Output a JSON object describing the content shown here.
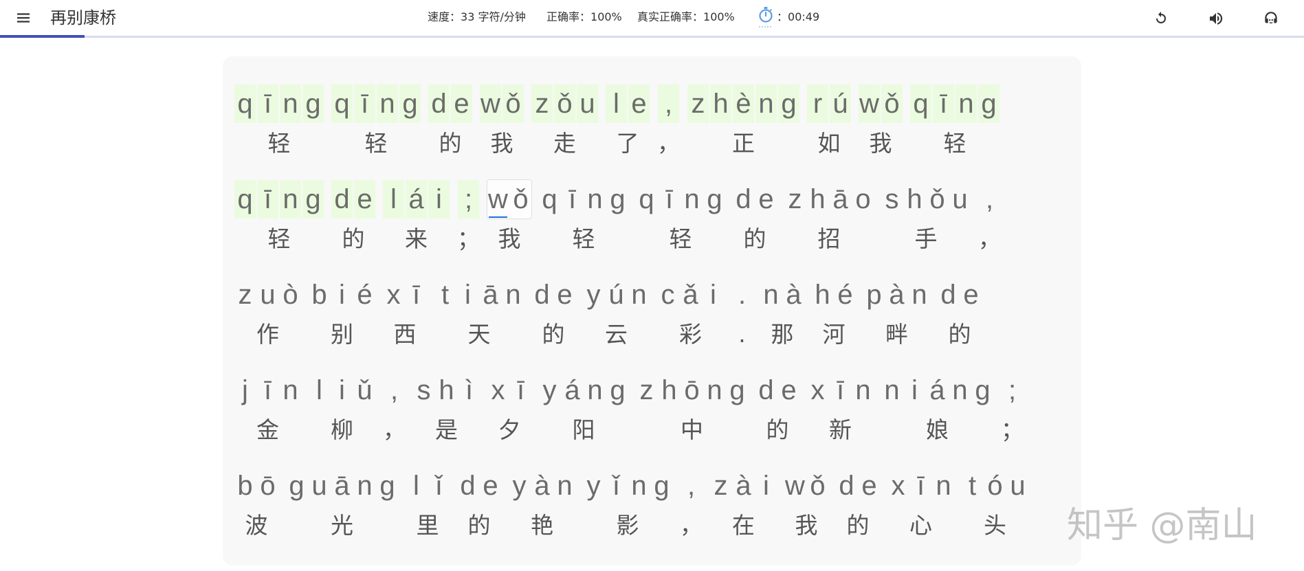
{
  "header": {
    "title": "再别康桥",
    "progress": 0.065,
    "stats": {
      "speed_label": "速度：",
      "speed_value": "33 字符/分钟",
      "accuracy_label": "正确率：",
      "accuracy_value": "100%",
      "real_accuracy_label": "真实正确率：",
      "real_accuracy_value": "100%",
      "timer_sep": "：",
      "timer_value": "00:49"
    }
  },
  "icons": {
    "menu": "menu-icon",
    "stopwatch": "stopwatch-icon",
    "restart": "refresh-icon",
    "sound": "volume-icon",
    "support": "headset-icon"
  },
  "colors": {
    "accent": "#3f51b5",
    "typed_bg": "#ebfbdf",
    "cursor": "#1e6fd9",
    "stopwatch": "#5c9ce6"
  },
  "cursor": {
    "line": 1,
    "word": 4,
    "letter": 0
  },
  "lines": [
    [
      {
        "py": "qīng",
        "hz": "轻"
      },
      {
        "py": "qīng",
        "hz": "轻"
      },
      {
        "py": "de",
        "hz": "的"
      },
      {
        "py": "wǒ",
        "hz": "我"
      },
      {
        "py": "zǒu",
        "hz": "走"
      },
      {
        "py": "le",
        "hz": "了"
      },
      {
        "py": ",",
        "hz": "，"
      },
      {
        "py": "zhèng",
        "hz": "正"
      },
      {
        "py": "rú",
        "hz": "如"
      },
      {
        "py": "wǒ",
        "hz": "我"
      },
      {
        "py": "qīng",
        "hz": "轻"
      }
    ],
    [
      {
        "py": "qīng",
        "hz": "轻"
      },
      {
        "py": "de",
        "hz": "的"
      },
      {
        "py": "lái",
        "hz": "来"
      },
      {
        "py": ";",
        "hz": "；"
      },
      {
        "py": "wǒ",
        "hz": "我"
      },
      {
        "py": "qīng",
        "hz": "轻"
      },
      {
        "py": "qīng",
        "hz": "轻"
      },
      {
        "py": "de",
        "hz": "的"
      },
      {
        "py": "zhāo",
        "hz": "招"
      },
      {
        "py": "shǒu",
        "hz": "手"
      },
      {
        "py": ",",
        "hz": "，"
      }
    ],
    [
      {
        "py": "zuò",
        "hz": "作"
      },
      {
        "py": "bié",
        "hz": "别"
      },
      {
        "py": "xī",
        "hz": "西"
      },
      {
        "py": "tiān",
        "hz": "天"
      },
      {
        "py": "de",
        "hz": "的"
      },
      {
        "py": "yún",
        "hz": "云"
      },
      {
        "py": "cǎi",
        "hz": "彩"
      },
      {
        "py": ".",
        "hz": "."
      },
      {
        "py": "nà",
        "hz": "那"
      },
      {
        "py": "hé",
        "hz": "河"
      },
      {
        "py": "pàn",
        "hz": "畔"
      },
      {
        "py": "de",
        "hz": "的"
      }
    ],
    [
      {
        "py": "jīn",
        "hz": "金"
      },
      {
        "py": "liǔ",
        "hz": "柳"
      },
      {
        "py": ",",
        "hz": "，"
      },
      {
        "py": "shì",
        "hz": "是"
      },
      {
        "py": "xī",
        "hz": "夕"
      },
      {
        "py": "yáng",
        "hz": "阳"
      },
      {
        "py": "zhōng",
        "hz": "中"
      },
      {
        "py": "de",
        "hz": "的"
      },
      {
        "py": "xīn",
        "hz": "新"
      },
      {
        "py": "niáng",
        "hz": "娘"
      },
      {
        "py": ";",
        "hz": "；"
      }
    ],
    [
      {
        "py": "bō",
        "hz": "波"
      },
      {
        "py": "guāng",
        "hz": "光"
      },
      {
        "py": "lǐ",
        "hz": "里"
      },
      {
        "py": "de",
        "hz": "的"
      },
      {
        "py": "yàn",
        "hz": "艳"
      },
      {
        "py": "yǐng",
        "hz": "影"
      },
      {
        "py": ",",
        "hz": "，"
      },
      {
        "py": "zài",
        "hz": "在"
      },
      {
        "py": "wǒ",
        "hz": "我"
      },
      {
        "py": "de",
        "hz": "的"
      },
      {
        "py": "xīn",
        "hz": "心"
      },
      {
        "py": "tóu",
        "hz": "头"
      }
    ]
  ],
  "watermark": "知乎 @南山"
}
